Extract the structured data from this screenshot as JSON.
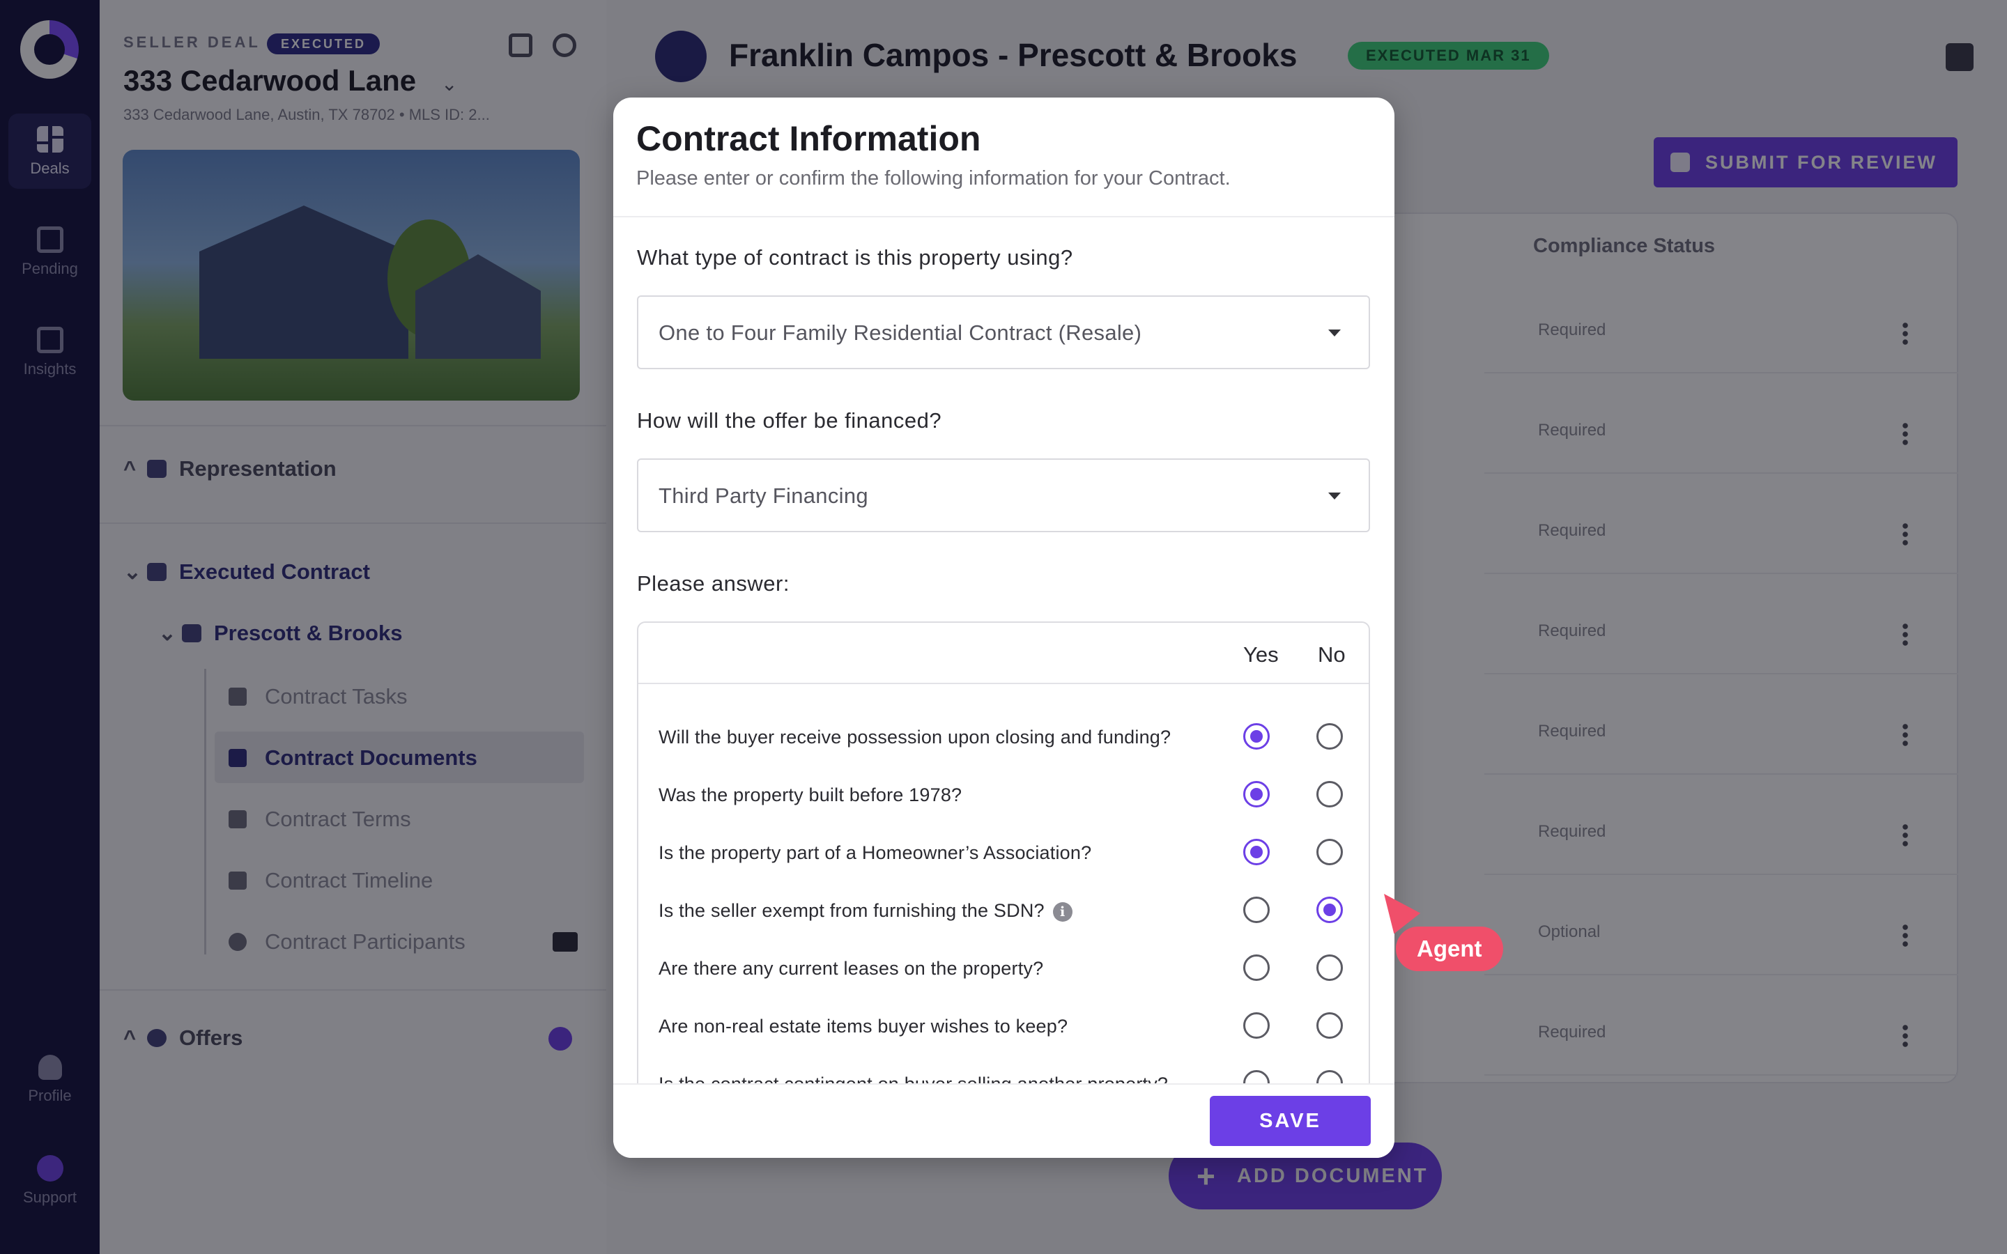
{
  "rail": {
    "items": [
      {
        "label": "Deals",
        "icon": "grid-icon",
        "active": true
      },
      {
        "label": "Pending",
        "icon": "table-icon",
        "active": false
      },
      {
        "label": "Insights",
        "icon": "chart-icon",
        "active": false
      }
    ],
    "bottom": [
      {
        "label": "Profile",
        "icon": "person-icon"
      },
      {
        "label": "Support",
        "icon": "lightbulb-icon"
      }
    ]
  },
  "deal": {
    "type_label": "SELLER DEAL",
    "status_badge": "EXECUTED",
    "title": "333 Cedarwood Lane",
    "address": "333 Cedarwood Lane, Austin, TX 78702 • MLS ID: 2..."
  },
  "nav": {
    "representation": "Representation",
    "executed_contract": "Executed Contract",
    "contract_name": "Prescott & Brooks",
    "sub_items": [
      {
        "label": "Contract Tasks",
        "icon": "checkbox-icon"
      },
      {
        "label": "Contract Documents",
        "icon": "document-icon",
        "active": true
      },
      {
        "label": "Contract Terms",
        "icon": "list-icon"
      },
      {
        "label": "Contract Timeline",
        "icon": "calendar-icon"
      },
      {
        "label": "Contract Participants",
        "icon": "people-icon"
      }
    ],
    "offers": "Offers"
  },
  "main": {
    "title": "Franklin Campos - Prescott & Brooks",
    "status_badge": "EXECUTED MAR 31",
    "submit_label": "SUBMIT FOR REVIEW",
    "column_header": "Compliance Status",
    "statuses": [
      "Required",
      "Required",
      "Required",
      "Required",
      "Required",
      "Required",
      "Optional",
      "Required"
    ],
    "add_document_label": "ADD DOCUMENT"
  },
  "modal": {
    "title": "Contract Information",
    "subtitle": "Please enter or confirm the following information for your Contract.",
    "q_contract_type": "What type of contract is this property using?",
    "contract_type_value": "One to Four Family Residential Contract (Resale)",
    "q_financing": "How will the offer be financed?",
    "financing_value": "Third Party Financing",
    "please_answer": "Please answer:",
    "yes_label": "Yes",
    "no_label": "No",
    "questions": [
      {
        "text": "Will the buyer receive possession upon closing and funding?",
        "answer": "yes"
      },
      {
        "text": "Was the property built before 1978?",
        "answer": "yes"
      },
      {
        "text": "Is the property part of a Homeowner’s Association?",
        "answer": "yes"
      },
      {
        "text": "Is the seller exempt from furnishing the SDN?",
        "answer": "no",
        "info": true
      },
      {
        "text": "Are there any current leases on the property?",
        "answer": null
      },
      {
        "text": "Are non-real estate items buyer wishes to keep?",
        "answer": null
      },
      {
        "text": "Is the contract contingent on buyer selling another property?",
        "answer": null
      }
    ],
    "info_glyph": "i",
    "save_label": "SAVE"
  },
  "agent": {
    "label": "Agent",
    "color": "#f04f6a"
  },
  "colors": {
    "accent": "#6c3fe6",
    "rail": "#14123e",
    "executed_badge": "#3fd27a"
  }
}
